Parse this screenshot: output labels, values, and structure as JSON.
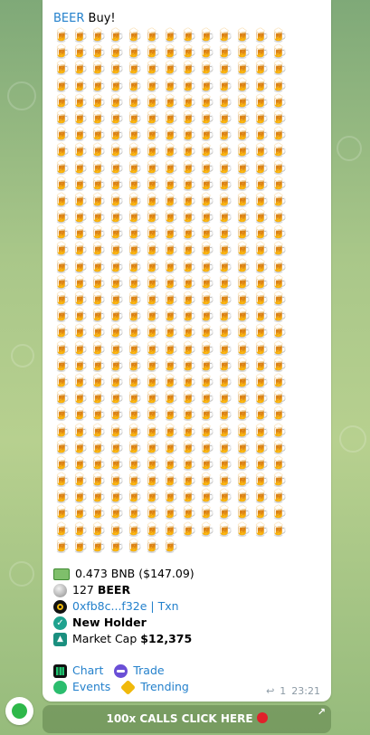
{
  "message": {
    "header_link": "BEER",
    "header_text": "Buy!",
    "beer_emoji": "🍺",
    "beer_rows": 32,
    "beer_per_row": 13,
    "last_row_count": 7,
    "info": {
      "amount": "0.473 BNB ($147.09)",
      "token_qty": "127",
      "token_symbol": "BEER",
      "tx_address": "0xfb8c...f32e",
      "tx_sep": " | ",
      "tx_label": "Txn",
      "new_holder": "New Holder",
      "market_cap_label": "Market Cap",
      "market_cap_value": "$12,375"
    },
    "buttons": {
      "chart": "Chart",
      "trade": "Trade",
      "events": "Events",
      "trending": "Trending"
    },
    "meta": {
      "reply_count": "1",
      "time": "23:21"
    }
  },
  "cta": {
    "label": "100x CALLS CLICK HERE"
  },
  "colors": {
    "link": "#2481cc",
    "bubble": "#ffffff"
  }
}
